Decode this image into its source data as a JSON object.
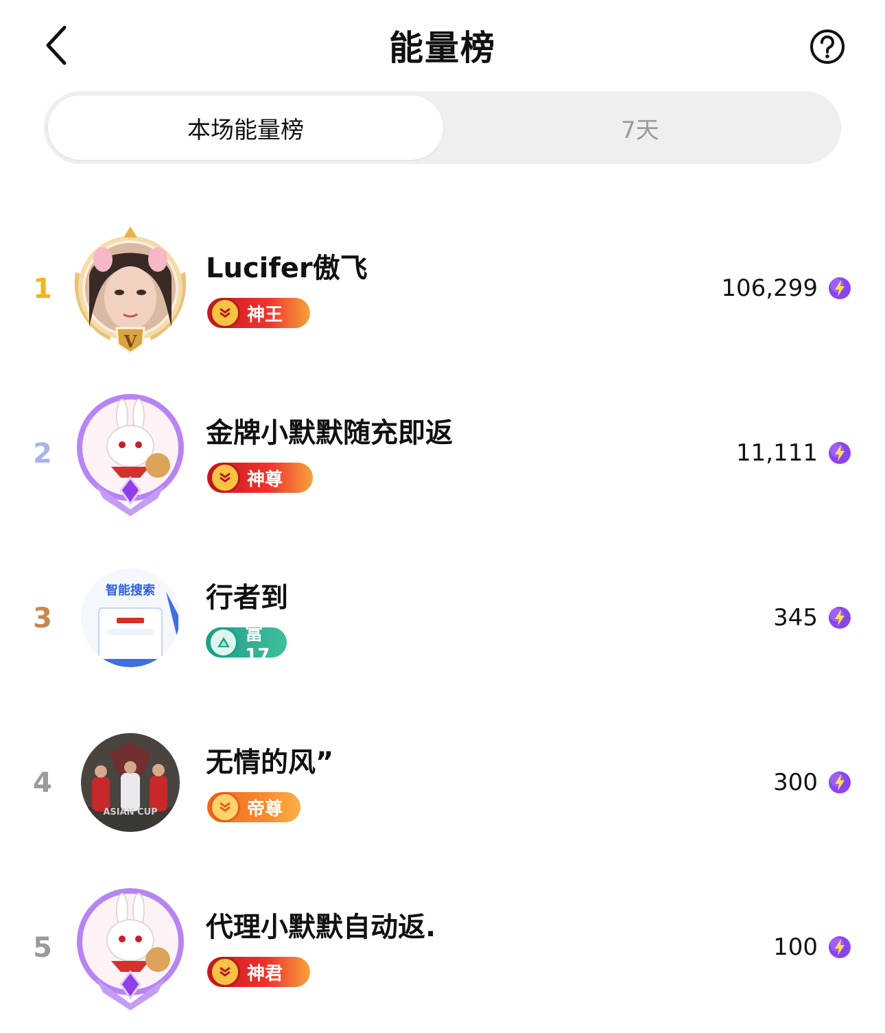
{
  "header": {
    "title": "能量榜",
    "back_icon": "chevron-left-icon",
    "help_icon": "question-circle-icon"
  },
  "tabs": [
    {
      "label": "本场能量榜",
      "active": true
    },
    {
      "label": "7天",
      "active": false
    }
  ],
  "colors": {
    "rank1": "#f0b321",
    "rank2": "#a9b3ea",
    "rank3": "#c9874e",
    "rank_other": "#9a9a9a",
    "tab_bg": "#efefef",
    "energy_icon": "#7b3ff2"
  },
  "ranking": [
    {
      "rank": "1",
      "name": "Lucifer傲飞",
      "badge": "神王",
      "energy": "106,299",
      "avatar": "woman-photo-with-gold-frame"
    },
    {
      "rank": "2",
      "name": "金牌小默默随充即返",
      "badge": "神尊",
      "energy": "11,111",
      "avatar": "rabbit-with-purple-frame"
    },
    {
      "rank": "3",
      "name": "行者到",
      "badge": "富17",
      "energy": "345",
      "avatar": "smart-search-app-ad"
    },
    {
      "rank": "4",
      "name": "无情的风”",
      "badge": "帝尊",
      "energy": "300",
      "avatar": "football-match-photo"
    },
    {
      "rank": "5",
      "name": "代理小默默自动返.",
      "badge": "神君",
      "energy": "100",
      "avatar": "rabbit-with-purple-frame"
    }
  ],
  "avatar_texts": {
    "rank3_line1": "智能搜索",
    "rank4_line1": "ASIAN CUP"
  }
}
